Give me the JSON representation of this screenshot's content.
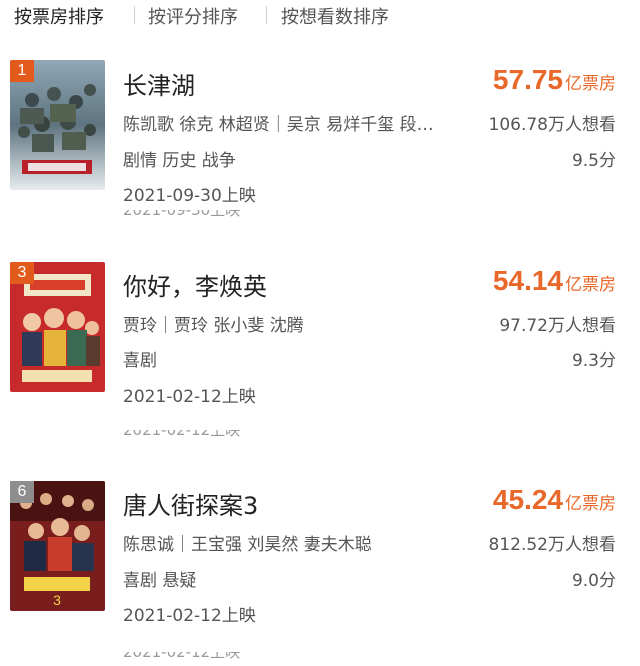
{
  "tabs": [
    {
      "label": "按票房排序",
      "active": true
    },
    {
      "label": "按评分排序",
      "active": false
    },
    {
      "label": "按想看数排序",
      "active": false
    }
  ],
  "colors": {
    "accent": "#e8682a",
    "rank_badge": "#e35a1d",
    "rank_badge_plain": "#8e8e8e"
  },
  "movies": [
    {
      "rank": "1",
      "title": "长津湖",
      "cast": "陈凯歌 徐克 林超贤｜吴京 易烊千玺 段…",
      "genres": "剧情 历史 战争",
      "release": "2021-09-30上映",
      "box_office": "57.75",
      "box_office_unit": "亿票房",
      "want_to_see": "106.78万人想看",
      "rating": "9.5分",
      "poster_icon": "movie-poster"
    },
    {
      "rank": "3",
      "title": "你好，李焕英",
      "cast": "贾玲｜贾玲 张小斐 沈腾",
      "genres": "喜剧",
      "release": "2021-02-12上映",
      "box_office": "54.14",
      "box_office_unit": "亿票房",
      "want_to_see": "97.72万人想看",
      "rating": "9.3分",
      "poster_icon": "movie-poster"
    },
    {
      "rank": "6",
      "title": "唐人街探案3",
      "cast": "陈思诚｜王宝强 刘昊然 妻夫木聪",
      "genres": "喜剧 悬疑",
      "release": "2021-02-12上映",
      "box_office": "45.24",
      "box_office_unit": "亿票房",
      "want_to_see": "812.52万人想看",
      "rating": "9.0分",
      "poster_icon": "movie-poster"
    }
  ]
}
